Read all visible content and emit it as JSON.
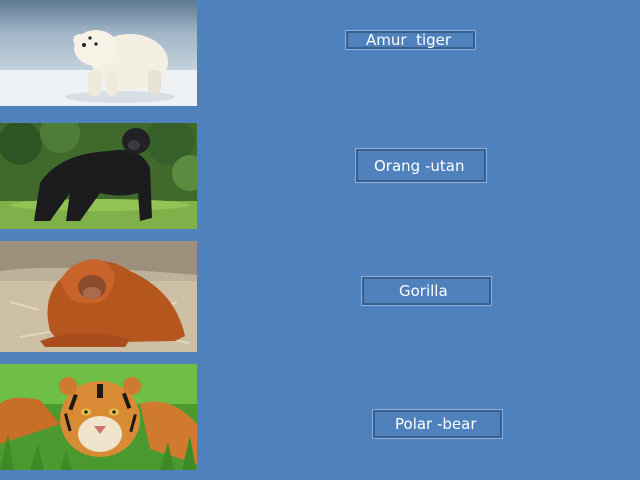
{
  "labels": {
    "first": "Amur  tiger",
    "second": "Orang -utan",
    "third": "Gorilla",
    "fourth": "Polar -bear"
  },
  "photos": [
    "polar-bear-photo",
    "gorilla-photo",
    "orangutan-photo",
    "tiger-photo"
  ],
  "colors": {
    "slide_background": "#4f81bd",
    "label_text": "#ffffff"
  }
}
